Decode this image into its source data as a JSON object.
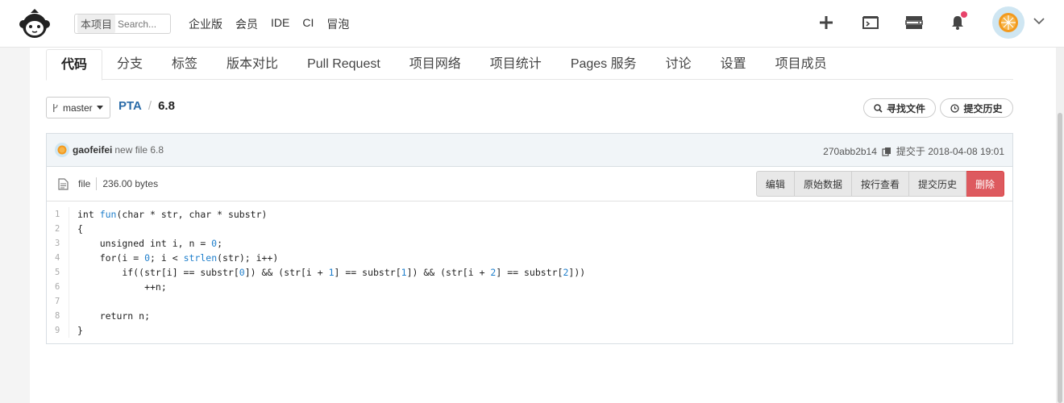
{
  "header": {
    "search": {
      "scope": "本项目",
      "placeholder": "Search..."
    },
    "nav": [
      "企业版",
      "会员",
      "IDE",
      "CI",
      "冒泡"
    ],
    "icons": [
      "plus-icon",
      "terminal-icon",
      "server-icon",
      "bell-icon",
      "avatar",
      "chevron-down-icon"
    ]
  },
  "tabs": [
    "代码",
    "分支",
    "标签",
    "版本对比",
    "Pull Request",
    "项目网络",
    "项目统计",
    "Pages 服务",
    "讨论",
    "设置",
    "项目成员"
  ],
  "branch": {
    "name": "master"
  },
  "breadcrumb": {
    "repo": "PTA",
    "sep": "/",
    "file": "6.8"
  },
  "actions": {
    "find_file": "寻找文件",
    "history": "提交历史"
  },
  "commit": {
    "author": "gaofeifei",
    "message": "new file 6.8",
    "hash": "270abb2b14",
    "date_label": "提交于 2018-04-08 19:01"
  },
  "file": {
    "type": "file",
    "size": "236.00 bytes",
    "buttons": {
      "edit": "编辑",
      "raw": "原始数据",
      "blame": "按行查看",
      "history": "提交历史",
      "delete": "删除"
    }
  },
  "code_lines": [
    {
      "n": "1",
      "t": "int fun(char * str, char * substr)"
    },
    {
      "n": "2",
      "t": "{"
    },
    {
      "n": "3",
      "t": "    unsigned int i, n = 0;"
    },
    {
      "n": "4",
      "t": "    for(i = 0; i < strlen(str); i++)"
    },
    {
      "n": "5",
      "t": "        if((str[i] == substr[0]) && (str[i + 1] == substr[1]) && (str[i + 2] == substr[2]))"
    },
    {
      "n": "6",
      "t": "            ++n;"
    },
    {
      "n": "7",
      "t": ""
    },
    {
      "n": "8",
      "t": "    return n;"
    },
    {
      "n": "9",
      "t": "}"
    }
  ]
}
